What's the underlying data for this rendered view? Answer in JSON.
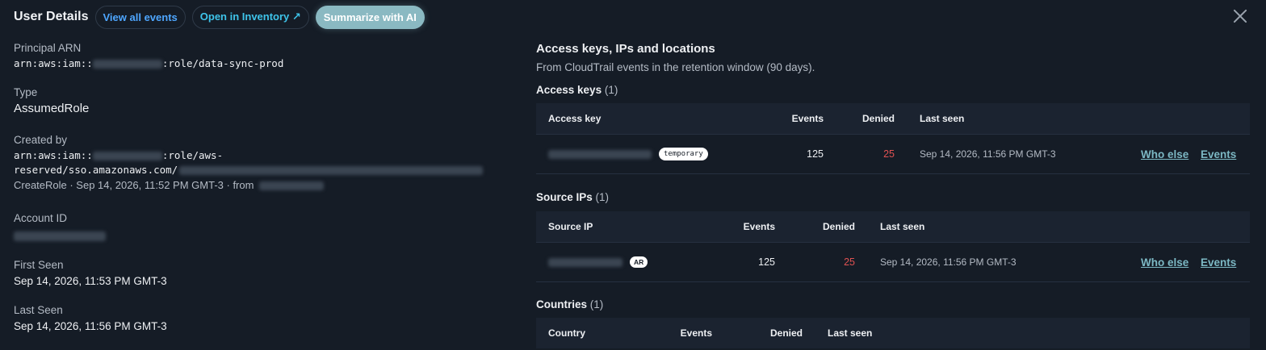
{
  "header": {
    "title": "User Details",
    "view_all_events": "View all events",
    "open_inventory": "Open in Inventory ↗",
    "summarize_ai": "Summarize with AI"
  },
  "details": {
    "principal_arn": {
      "label": "Principal ARN",
      "prefix": "arn:aws:iam::",
      "suffix": ":role/data-sync-prod"
    },
    "type": {
      "label": "Type",
      "value": "AssumedRole"
    },
    "created_by": {
      "label": "Created by",
      "line1_prefix": "arn:aws:iam::",
      "line1_suffix": ":role/aws-",
      "line2": "reserved/sso.amazonaws.com/",
      "event_line": "CreateRole · Sep 14, 2026, 11:52 PM GMT-3 · from"
    },
    "account_id": {
      "label": "Account ID"
    },
    "first_seen": {
      "label": "First Seen",
      "value": "Sep 14, 2026, 11:53 PM GMT-3"
    },
    "last_seen": {
      "label": "Last Seen",
      "value": "Sep 14, 2026, 11:56 PM GMT-3"
    }
  },
  "access": {
    "title": "Access keys, IPs and locations",
    "description": "From CloudTrail events in the retention window (90 days).",
    "access_keys": {
      "title": "Access keys",
      "count": "(1)",
      "columns": {
        "key": "Access key",
        "events": "Events",
        "denied": "Denied",
        "last_seen": "Last seen"
      },
      "rows": [
        {
          "tag": "temporary",
          "events": "125",
          "denied": "25",
          "last_seen": "Sep 14, 2026, 11:56 PM GMT-3",
          "who_else": "Who else",
          "events_link": "Events"
        }
      ]
    },
    "source_ips": {
      "title": "Source IPs",
      "count": "(1)",
      "columns": {
        "ip": "Source IP",
        "events": "Events",
        "denied": "Denied",
        "last_seen": "Last seen"
      },
      "rows": [
        {
          "tag": "AR",
          "events": "125",
          "denied": "25",
          "last_seen": "Sep 14, 2026, 11:56 PM GMT-3",
          "who_else": "Who else",
          "events_link": "Events"
        }
      ]
    },
    "countries": {
      "title": "Countries",
      "count": "(1)",
      "columns": {
        "country": "Country",
        "events": "Events",
        "denied": "Denied",
        "last_seen": "Last seen"
      }
    }
  },
  "icons": {
    "close": "close-icon",
    "external": "external-link-icon"
  },
  "colors": {
    "background": "#151c26",
    "accent_blue": "#4ea6ff",
    "accent_cyan": "#3ec4ea",
    "ai_button": "#8ab9c2",
    "denied": "#e05252",
    "link": "#7cb8c4"
  }
}
